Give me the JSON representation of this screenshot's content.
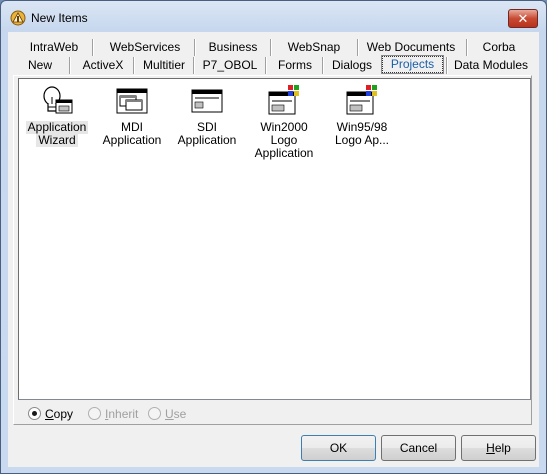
{
  "window": {
    "title": "New Items",
    "close_symbol": "✕"
  },
  "tabs": {
    "row1": [
      "IntraWeb",
      "WebServices",
      "Business",
      "WebSnap",
      "Web Documents",
      "Corba"
    ],
    "row2": [
      "New",
      "ActiveX",
      "Multitier",
      "P7_OBOL",
      "Forms",
      "Dialogs",
      "Projects",
      "Data Modules"
    ],
    "active": "Projects"
  },
  "items": [
    {
      "line1": "Application",
      "line2": "Wizard",
      "icon": "wizard-lightbulb-icon",
      "selected": true
    },
    {
      "line1": "MDI",
      "line2": "Application",
      "icon": "mdi-window-icon"
    },
    {
      "line1": "SDI",
      "line2": "Application",
      "icon": "sdi-window-icon"
    },
    {
      "line1": "Win2000 Logo",
      "line2": "Application",
      "icon": "win2000-logo-app-icon"
    },
    {
      "line1": "Win95/98",
      "line2": "Logo Ap...",
      "icon": "win9x-logo-app-icon"
    }
  ],
  "options": {
    "copy": {
      "first": "C",
      "rest": "opy",
      "checked": true
    },
    "inherit": {
      "first": "I",
      "rest": "nherit",
      "enabled": false
    },
    "use": {
      "first": "U",
      "rest": "se",
      "enabled": false
    }
  },
  "buttons": {
    "ok": "OK",
    "cancel": "Cancel",
    "help_first": "H",
    "help_rest": "elp"
  },
  "colors": {
    "active_tab_text": "#1b5fa8",
    "close_button": "#c84a33",
    "selection": "#e6e6e6"
  }
}
